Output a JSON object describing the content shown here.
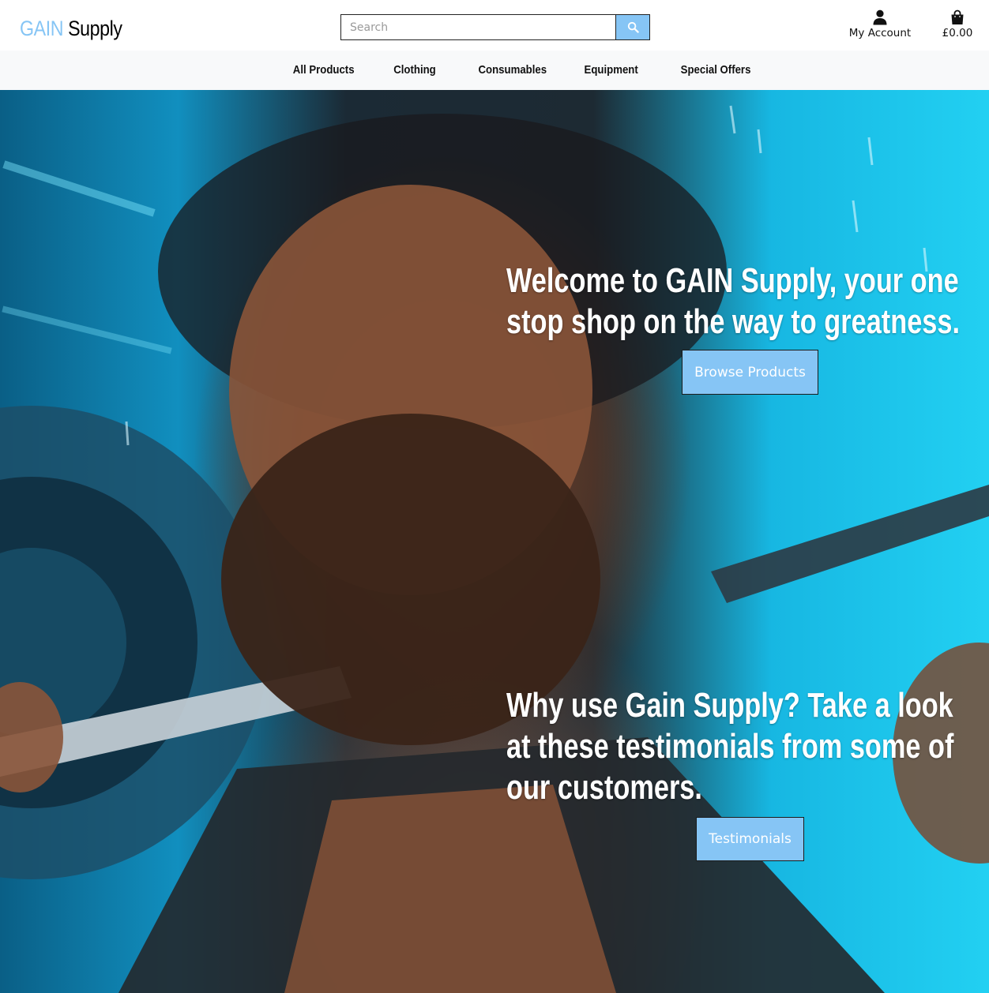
{
  "header": {
    "logo_brand": "GAIN",
    "logo_rest": "Supply",
    "search_placeholder": "Search",
    "account_label": "My Account",
    "bag_total": "£0.00"
  },
  "nav": {
    "items": [
      "All Products",
      "Clothing",
      "Consumables",
      "Equipment",
      "Special Offers"
    ]
  },
  "hero": {
    "title": "Welcome to GAIN Supply, your one stop shop on the way to greatness.",
    "cta_label": "Browse Products",
    "testimonials_text": "Why use Gain Supply? Take a look at these testimonials from some of our customers.",
    "testimonials_button": "Testimonials"
  },
  "icons": {
    "search": "search-icon",
    "account": "user-icon",
    "bag": "shopping-bag-icon"
  },
  "colors": {
    "accent": "#86c5f5",
    "nav_background": "#f8f9fa",
    "text": "#000000"
  }
}
